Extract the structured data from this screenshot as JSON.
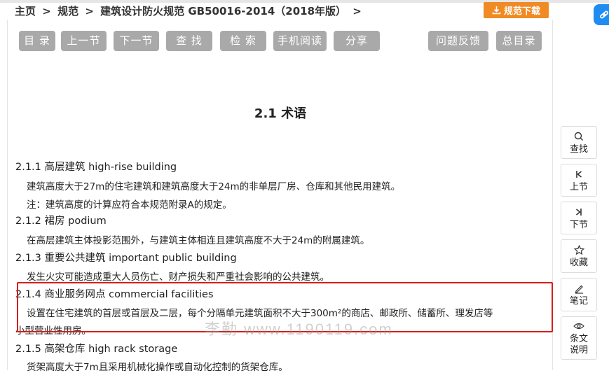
{
  "breadcrumb": {
    "home": "主页",
    "sep": ">",
    "spec": "规范",
    "doc": "建筑设计防火规范 GB50016-2014（2018年版）"
  },
  "download": {
    "label": "规范下载",
    "color": "#f08a24",
    "icon": "download-icon"
  },
  "toolbar": {
    "contents": "目 录",
    "prev": "上一节",
    "next": "下一节",
    "find": "查 找",
    "search": "检 索",
    "mobile": "手机阅读",
    "share": "分享",
    "feedback": "问题反馈",
    "index": "总目录"
  },
  "section": {
    "title": "2.1  术语"
  },
  "terms": [
    {
      "heading": "2.1.1 高层建筑 high-rise building",
      "body": "建筑高度大于27m的住宅建筑和建筑高度大于24m的非单层厂房、仓库和其他民用建筑。",
      "note": "注：建筑高度的计算应符合本规范附录A的规定。"
    },
    {
      "heading": "2.1.2 裙房 podium",
      "body": "在高层建筑主体投影范围外，与建筑主体相连且建筑高度不大于24m的附属建筑。"
    },
    {
      "heading": "2.1.3 重要公共建筑 important public building",
      "body": "发生火灾可能造成重大人员伤亡、财产损失和严重社会影响的公共建筑。"
    },
    {
      "heading": "2.1.4 商业服务网点 commercial facilities",
      "body": "设置在住宅建筑的首层或首层及二层，每个分隔单元建筑面积不大于300m²的商店、邮政所、储蓄所、理发店等",
      "body2": "小型营业性用房。"
    },
    {
      "heading": "2.1.5 高架仓库 high rack storage",
      "body": "货架高度大于7m且采用机械化操作或自动化控制的货架仓库。"
    }
  ],
  "watermark": "李勤  www.1190119.com",
  "sidebar": {
    "search": "查找",
    "prev": "上节",
    "next": "下节",
    "favorite": "收藏",
    "notes": "笔记",
    "explain": "条文说明"
  },
  "colors": {
    "accent": "#f08a24",
    "toolbar_bg": "#a9a9a9",
    "highlight": "#d61d1d",
    "badge": "#1f8cf2"
  }
}
